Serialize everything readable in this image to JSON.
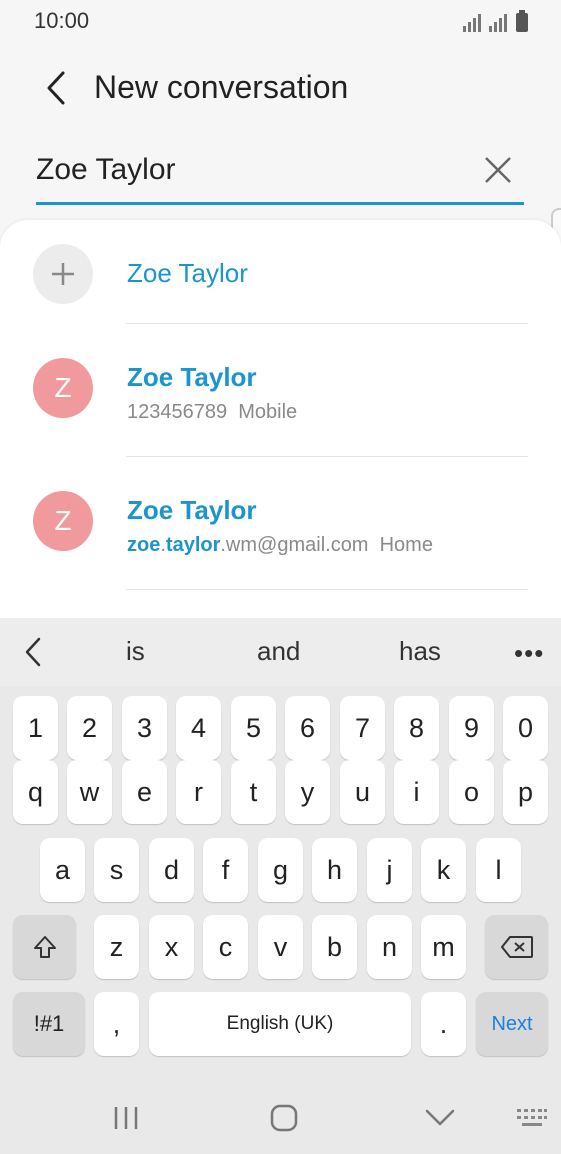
{
  "status_bar": {
    "time": "10:00"
  },
  "header": {
    "title": "New conversation"
  },
  "search": {
    "value": "Zoe Taylor"
  },
  "results": {
    "add_new": {
      "name": "Zoe Taylor"
    },
    "contacts": [
      {
        "initial": "Z",
        "name": "Zoe Taylor",
        "number": "123456789",
        "label": "Mobile"
      },
      {
        "initial": "Z",
        "name": "Zoe Taylor",
        "email_match_1": "zoe",
        "email_sep": ".",
        "email_match_2": "taylor",
        "email_rest": ".wm@gmail.com",
        "label": "Home"
      }
    ]
  },
  "keyboard": {
    "suggestions": [
      "is",
      "and",
      "has"
    ],
    "more": "•••",
    "row_numbers": [
      "1",
      "2",
      "3",
      "4",
      "5",
      "6",
      "7",
      "8",
      "9",
      "0"
    ],
    "row1": [
      "q",
      "w",
      "e",
      "r",
      "t",
      "y",
      "u",
      "i",
      "o",
      "p"
    ],
    "row2": [
      "a",
      "s",
      "d",
      "f",
      "g",
      "h",
      "j",
      "k",
      "l"
    ],
    "row3": [
      "z",
      "x",
      "c",
      "v",
      "b",
      "n",
      "m"
    ],
    "symbols": "!#1",
    "comma": ",",
    "space": "English (UK)",
    "period": ".",
    "next": "Next"
  }
}
